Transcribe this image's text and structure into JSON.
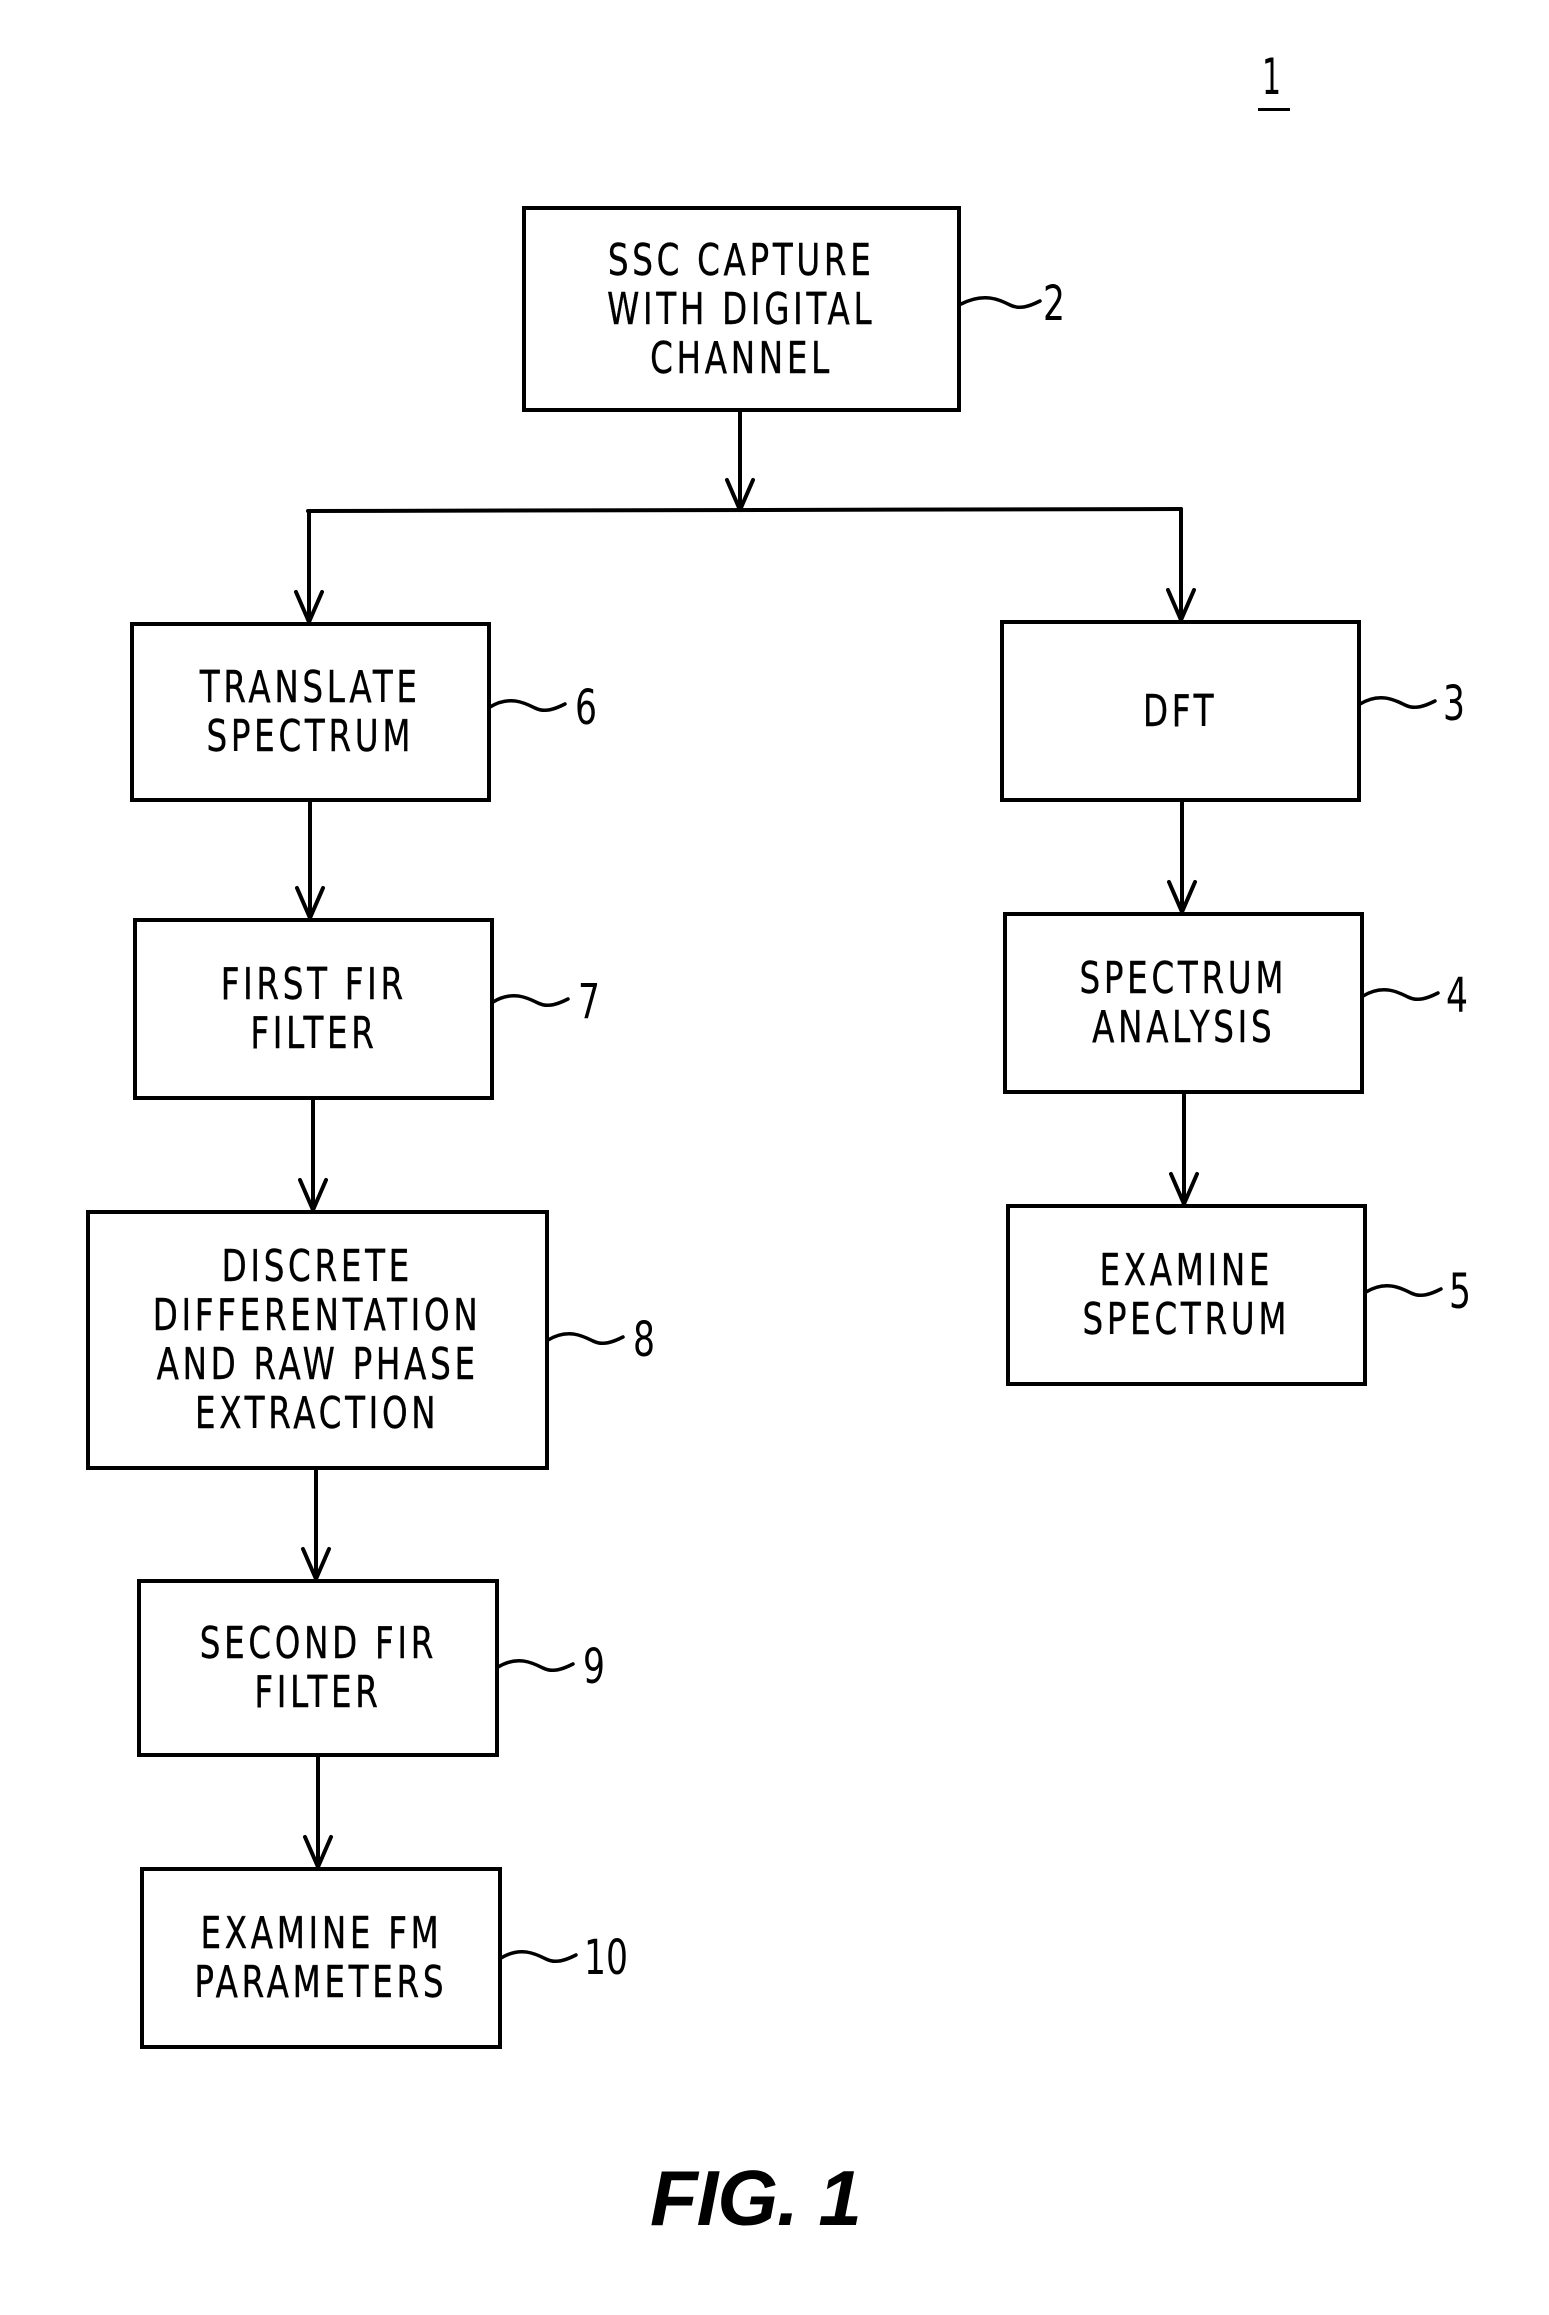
{
  "figure": {
    "id_label": "1",
    "caption": "FIG. 1"
  },
  "blocks": [
    {
      "ref": "2",
      "lines": [
        "SSC CAPTURE",
        "WITH DIGITAL",
        "CHANNEL"
      ]
    },
    {
      "ref": "3",
      "lines": [
        "DFT"
      ]
    },
    {
      "ref": "4",
      "lines": [
        "SPECTRUM",
        "ANALYSIS"
      ]
    },
    {
      "ref": "5",
      "lines": [
        "EXAMINE",
        "SPECTRUM"
      ]
    },
    {
      "ref": "6",
      "lines": [
        "TRANSLATE",
        "SPECTRUM"
      ]
    },
    {
      "ref": "7",
      "lines": [
        "FIRST FIR",
        "FILTER"
      ]
    },
    {
      "ref": "8",
      "lines": [
        "DISCRETE",
        "DIFFERENTATION",
        "AND RAW PHASE",
        "EXTRACTION"
      ]
    },
    {
      "ref": "9",
      "lines": [
        "SECOND FIR",
        "FILTER"
      ]
    },
    {
      "ref": "10",
      "lines": [
        "EXAMINE FM",
        "PARAMETERS"
      ]
    }
  ],
  "flows": [
    {
      "from": "2",
      "to": [
        "6",
        "3"
      ],
      "type": "branch"
    },
    {
      "from": "3",
      "to": "4"
    },
    {
      "from": "4",
      "to": "5"
    },
    {
      "from": "6",
      "to": "7"
    },
    {
      "from": "7",
      "to": "8"
    },
    {
      "from": "8",
      "to": "9"
    },
    {
      "from": "9",
      "to": "10"
    }
  ],
  "colors": {
    "ink": "#000000",
    "paper": "#ffffff"
  }
}
